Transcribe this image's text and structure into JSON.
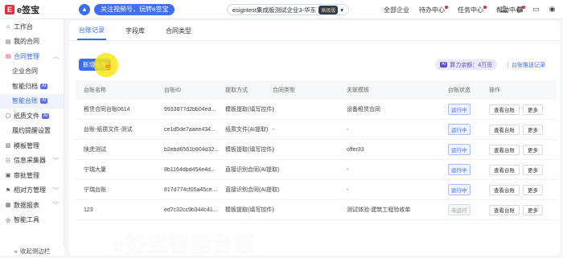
{
  "app": {
    "logo_mark": "E",
    "logo_text": "e签宝"
  },
  "header": {
    "promo": "关注视频号，玩转e签宝",
    "tenant": "esigntest集成版测试企业3-华东",
    "vip_badge": "高级版",
    "nav": [
      "全部企业",
      "待办中心",
      "任务中心",
      "帮助中心"
    ],
    "icons": [
      "bell-icon",
      "grid-icon",
      "monitor-icon",
      "user-icon"
    ]
  },
  "sidebar": {
    "items": [
      {
        "label": "工作台",
        "icon": "home-icon",
        "type": "item"
      },
      {
        "label": "我的合同",
        "icon": "doc-icon",
        "type": "item"
      },
      {
        "label": "合同管理",
        "icon": "doc-red-icon",
        "type": "group"
      },
      {
        "label": "企业合同",
        "type": "sub"
      },
      {
        "label": "智能归档",
        "type": "sub",
        "ai": "AI"
      },
      {
        "label": "智能台账",
        "type": "sub-active",
        "ai": "AI"
      },
      {
        "label": "纸质文件",
        "icon": "file-icon",
        "type": "sub",
        "ai": "AI"
      },
      {
        "label": "履约提醒设置",
        "type": "sub"
      },
      {
        "label": "模板管理",
        "icon": "template-icon",
        "type": "item"
      },
      {
        "label": "信息采集器",
        "icon": "collect-icon",
        "type": "item"
      },
      {
        "label": "审批管理",
        "icon": "approve-icon",
        "type": "item"
      },
      {
        "label": "相对方管理",
        "icon": "party-icon",
        "type": "item"
      },
      {
        "label": "数据报表",
        "icon": "report-icon",
        "type": "item"
      },
      {
        "label": "智能工具",
        "icon": "tool-icon",
        "type": "item"
      }
    ],
    "collapse_label": "收起侧边栏"
  },
  "main": {
    "tabs": [
      "台账记录",
      "字段库",
      "合同类型"
    ],
    "new_button": "新增台账",
    "quota_ai": "AI",
    "quota": "算力余额：4万页",
    "quota_link": "台账推送记录",
    "columns": [
      "台账名称",
      "台账ID",
      "提取方式",
      "合同类型",
      "关联模板",
      "台账状态",
      "操作"
    ],
    "rows": [
      {
        "name": "租赁合同台账0614",
        "id": "9933877d2bb04ed...",
        "method": "模板提取(填写控件)",
        "type": "-",
        "template": "设备租赁合同",
        "status": "运行中",
        "running": true
      },
      {
        "name": "台账-纸质文件-测试",
        "id": "ce1d5de7aaee434...",
        "method": "纸质文件(AI提取)",
        "type": "-",
        "template": "-",
        "status": "运行中",
        "running": true
      },
      {
        "name": "陕虎测试",
        "id": "b2ebd6561b904d32...",
        "method": "模板提取(填写控件)",
        "type": "-",
        "template": "offer33",
        "status": "运行中",
        "running": true
      },
      {
        "name": "宁瑞大厦",
        "id": "8b1164dbd454e4d...",
        "method": "直接识别合同(AI提取)",
        "type": "-",
        "template": "-",
        "status": "运行中",
        "running": true
      },
      {
        "name": "宁瑞台账",
        "id": "817d774cf05a45ce...",
        "method": "直接识别合同(AI提取)",
        "type": "-",
        "template": "-",
        "status": "运行中",
        "running": true
      },
      {
        "name": "123",
        "id": "ed7c32cc9b344c41...",
        "method": "模板提取(填写控件)",
        "type": "-",
        "template": "测试体验-建筑工程验收单",
        "status": "未运行",
        "running": false
      }
    ],
    "actions": [
      "查看台账",
      "更多"
    ]
  },
  "overlay": {
    "watermark": "e签宝智能台账"
  }
}
